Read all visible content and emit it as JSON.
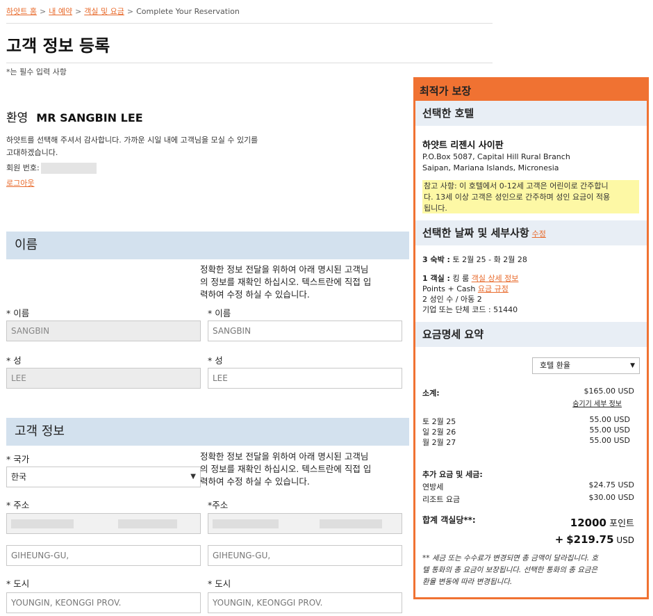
{
  "breadcrumb": {
    "home": "하얏트 홈",
    "my_reservation": "내 예약",
    "rooms_rates": "객실 및 요금",
    "current": "Complete Your Reservation"
  },
  "page": {
    "title": "고객 정보 등록",
    "required_note": "*는 필수 입력 사항"
  },
  "welcome": {
    "label": "환영",
    "name": "MR SANGBIN LEE",
    "thanks_line1": "하얏트를 선택해 주셔서 감사합니다. 가까운 시일 내에 고객님을 모실 수 있기를",
    "thanks_line2": "고대하겠습니다.",
    "member_label": "회원 번호:",
    "logout": "로그아웃"
  },
  "name_section": {
    "title": "이름",
    "helper_line1": "정확한 정보 전달을 위하여 아래 명시된 고객님",
    "helper_line2": "의 정보를 재확인 하십시오. 텍스트란에 직접 입",
    "helper_line3": "력하여 수정 하실 수 있습니다.",
    "first_label_left": "* 이름",
    "first_value_left": "SANGBIN",
    "first_label_right": "* 이름",
    "first_value_right": "SANGBIN",
    "last_label_left": "* 성",
    "last_value_left": "LEE",
    "last_label_right": "* 성",
    "last_value_right": "LEE"
  },
  "guest_section": {
    "title": "고객 정보",
    "country_label": "* 국가",
    "country_value": "한국",
    "helper_line1": "정확한 정보 전달을 위하여 아래 명시된 고객님",
    "helper_line2": "의 정보를 재확인 하십시오. 텍스트란에 직접 입",
    "helper_line3": "력하여 수정 하실 수 있습니다.",
    "address_label_left": "* 주소",
    "address_label_right": "*주소",
    "address2_left": "GIHEUNG-GU,",
    "address2_right": "GIHEUNG-GU,",
    "city_label_left": "* 도시",
    "city_label_right": "* 도시",
    "city_left": "YOUNGIN, KEONGGI PROV.",
    "city_right": "YOUNGIN, KEONGGI PROV."
  },
  "sidebar": {
    "header": "최적가 보장",
    "hotel_section": "선택한 호텔",
    "hotel_name": "하얏트 리젠시 사이판",
    "address_line1": "P.O.Box 5087, Capital Hill Rural Branch",
    "address_line2": "Saipan, Mariana Islands, Micronesia",
    "note_line1": "참고 사항: 이 호텔에서 0-12세 고객은 어린이로 간주합니",
    "note_line2": "다. 13세 이상 고객은 성인으로 간주하며 성인 요금이 적용",
    "note_line3": "됩니다.",
    "dates_section": "선택한 날짜 및 세부사항",
    "edit_link": "수정",
    "nights_bold": "3 숙박 :",
    "nights_text": "토 2월 25 - 화 2월 28",
    "rooms_bold": "1 객실 :",
    "rooms_text": "킹 룸",
    "room_details_link": "객실 상세 정보",
    "points_cash": "Points + Cash",
    "rate_rules_link": "요금 규정",
    "guests": "2 성인 수 / 아동 2",
    "corp_code": "기업 또는 단체 코드 : 51440",
    "summary_section": "요금명세 요약",
    "currency_select": "호텔 환율",
    "subtotal_label": "소계:",
    "subtotal_value": "$165.00 USD",
    "hide_details_link": "숨기기 세부 정보",
    "nights": [
      {
        "date": "토 2월 25",
        "amount": "55.00 USD"
      },
      {
        "date": "일 2월 26",
        "amount": "55.00 USD"
      },
      {
        "date": "월 2월 27",
        "amount": "55.00 USD"
      }
    ],
    "extra_label": "추가 요금 및 세금:",
    "tax_label": "연방세",
    "tax_value": "$24.75 USD",
    "resort_label": "리조트 요금",
    "resort_value": "$30.00 USD",
    "total_label": "합계 객실당**:",
    "total_points": "12000",
    "points_unit": "포인트",
    "plus": "+",
    "total_usd": "$219.75",
    "usd_unit": "USD",
    "disclaimer_line1": "** 세금 또는 수수료가 변경되면 총 금액이 달라집니다. 호",
    "disclaimer_line2": "텔 통화의 총 요금이 보장됩니다. 선택한 통화의 총 요금은",
    "disclaimer_line3": "환율 변동에 따라 변경됩니다."
  }
}
